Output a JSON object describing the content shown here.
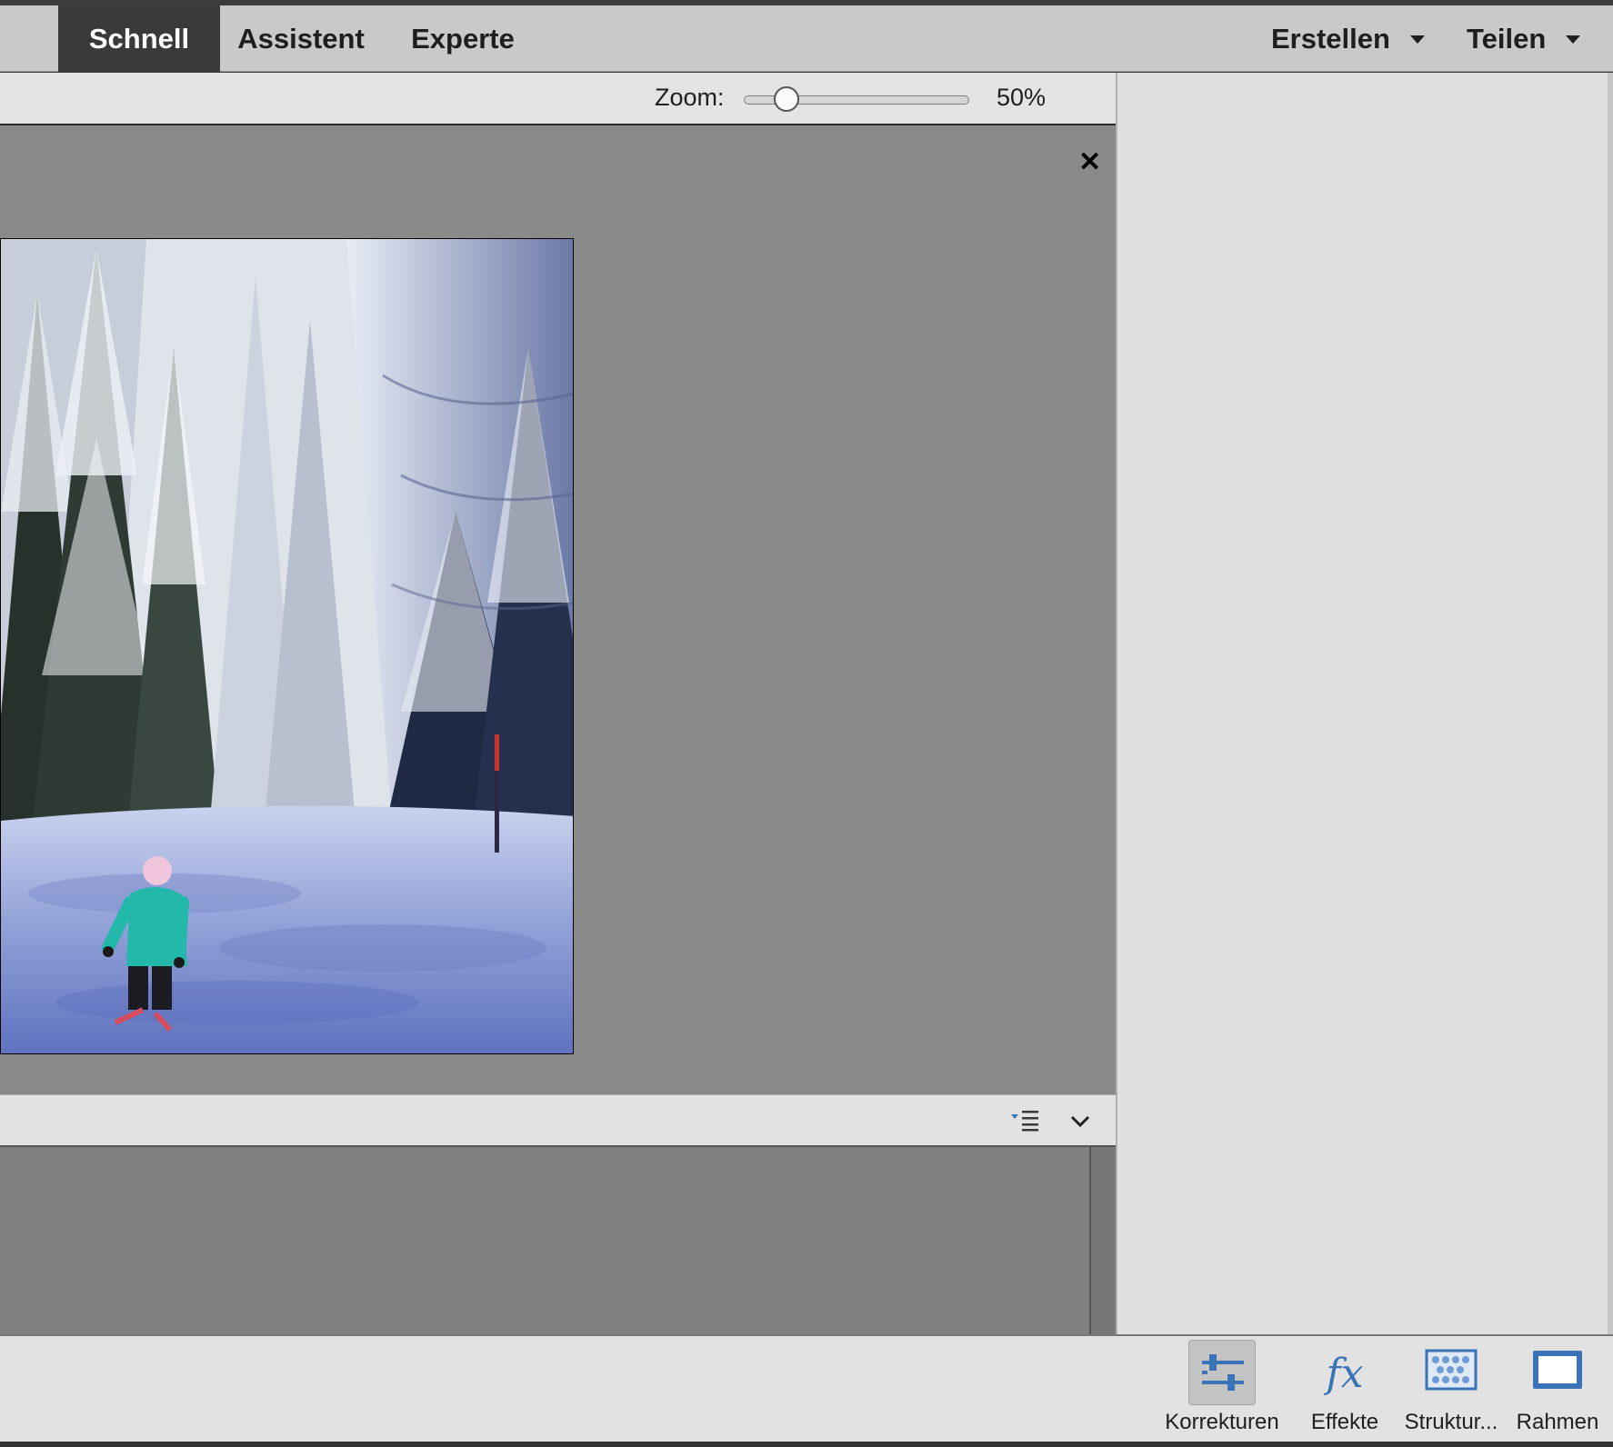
{
  "mode_tabs": [
    {
      "label": "Schnell",
      "active": true
    },
    {
      "label": "Assistent",
      "active": false
    },
    {
      "label": "Experte",
      "active": false
    }
  ],
  "menus": {
    "create_label": "Erstellen",
    "share_label": "Teilen"
  },
  "zoom": {
    "label": "Zoom:",
    "value_text": "50%",
    "slider_fraction": 0.19
  },
  "canvas": {
    "close_icon": "close-icon",
    "photo_subject": "child skiing on snowy slope between snow-covered fir trees"
  },
  "bin": {
    "options_icon": "list-options-icon",
    "collapse_icon": "chevron-down-icon"
  },
  "toolbar": {
    "items": [
      {
        "label": "Korrekturen",
        "icon": "adjustments-icon",
        "active": true
      },
      {
        "label": "Effekte",
        "icon": "fx-icon",
        "active": false
      },
      {
        "label": "Struktur...",
        "icon": "texture-icon",
        "active": false
      },
      {
        "label": "Rahmen",
        "icon": "frame-icon",
        "active": false
      }
    ]
  },
  "colors": {
    "active_tab_bg": "#3a3a3a",
    "icon_blue": "#3a73b8",
    "canvas_gray": "#8a8a8a"
  }
}
